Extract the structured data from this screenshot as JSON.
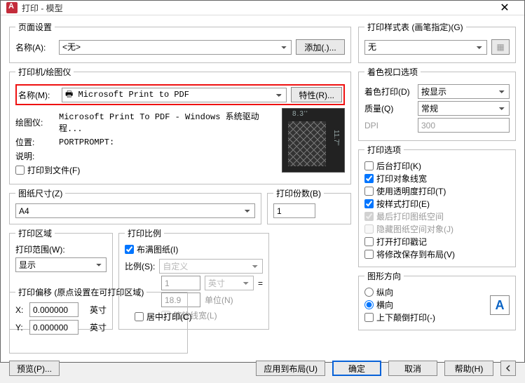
{
  "titlebar": {
    "title": "打印 - 模型"
  },
  "pageSetup": {
    "legend": "页面设置",
    "nameLabel": "名称(A):",
    "nameValue": "<无>",
    "addBtn": "添加(.)..."
  },
  "printer": {
    "legend": "打印机/绘图仪",
    "nameLabel": "名称(M):",
    "nameValue": "Microsoft Print to PDF",
    "propsBtn": "特性(R)...",
    "plotterLabel": "绘图仪:",
    "plotterValue": "Microsoft Print To PDF - Windows 系统驱动程...",
    "locationLabel": "位置:",
    "locationValue": "PORTPROMPT:",
    "descLabel": "说明:",
    "toFileLabel": "打印到文件(F)",
    "preview": {
      "w": "8.3''",
      "h": "11.7''"
    }
  },
  "paperSize": {
    "legend": "图纸尺寸(Z)",
    "value": "A4"
  },
  "copies": {
    "legend": "打印份数(B)",
    "value": "1"
  },
  "plotArea": {
    "legend": "打印区域",
    "rangeLabel": "打印范围(W):",
    "rangeValue": "显示"
  },
  "plotScale": {
    "legend": "打印比例",
    "fitLabel": "布满图纸(I)",
    "scaleLabel": "比例(S):",
    "scaleValue": "自定义",
    "num1": "1",
    "unit1": "英寸",
    "eq": "=",
    "num2": "18.9",
    "unit2": "单位(N)",
    "scaleLwLabel": "缩放线宽(L)"
  },
  "offset": {
    "legend": "打印偏移 (原点设置在可打印区域)",
    "xLabel": "X:",
    "xValue": "0.000000",
    "xUnit": "英寸",
    "yLabel": "Y:",
    "yValue": "0.000000",
    "yUnit": "英寸",
    "centerLabel": "居中打印(C)"
  },
  "styleTable": {
    "legend": "打印样式表 (画笔指定)(G)",
    "value": "无"
  },
  "viewport": {
    "legend": "着色视口选项",
    "shadeLabel": "着色打印(D)",
    "shadeValue": "按显示",
    "qualityLabel": "质量(Q)",
    "qualityValue": "常规",
    "dpiLabel": "DPI",
    "dpiValue": "300"
  },
  "options": {
    "legend": "打印选项",
    "items": {
      "bg": "后台打印(K)",
      "lw": "打印对象线宽",
      "trans": "使用透明度打印(T)",
      "styles": "按样式打印(E)",
      "psLast": "最后打印图纸空间",
      "hidePs": "隐藏图纸空间对象(J)",
      "stamp": "打开打印戳记",
      "save": "将修改保存到布局(V)"
    }
  },
  "orientation": {
    "legend": "图形方向",
    "portrait": "纵向",
    "landscape": "横向",
    "upsideDown": "上下颠倒打印(-)"
  },
  "footer": {
    "preview": "预览(P)...",
    "applyLayout": "应用到布局(U)",
    "ok": "确定",
    "cancel": "取消",
    "help": "帮助(H)"
  }
}
